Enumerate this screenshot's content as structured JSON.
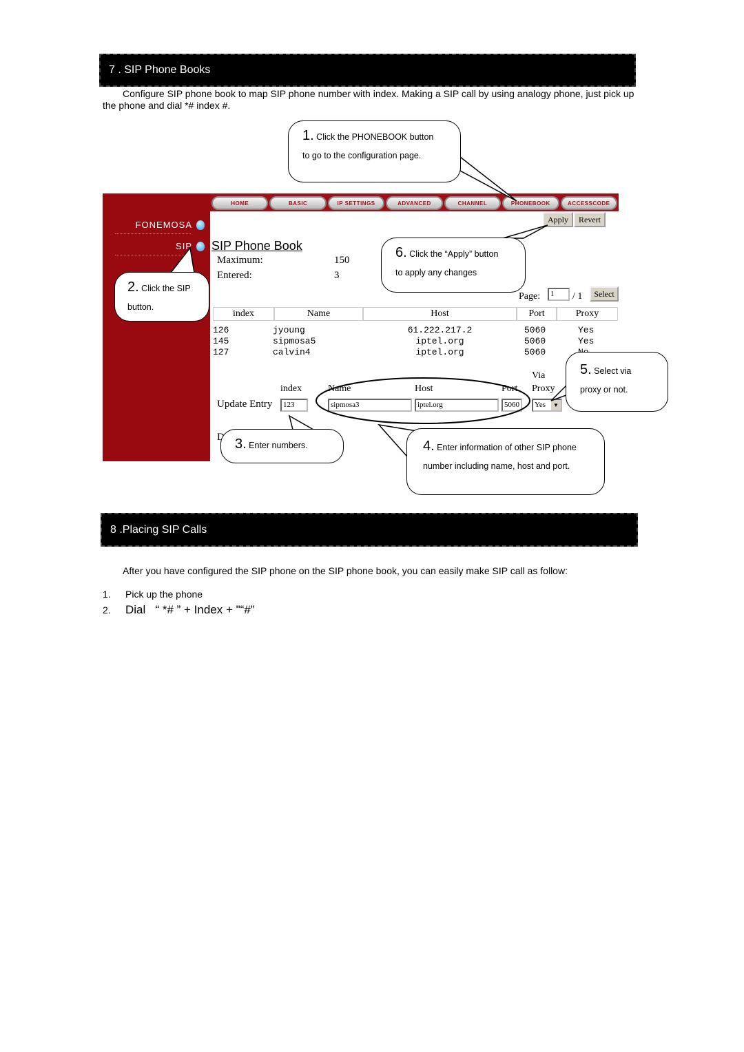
{
  "section7": {
    "title": "7 . SIP Phone Books",
    "intro": "Configure SIP phone book to map SIP phone number with index. Making a SIP call by using analogy phone, just pick up the phone and dial *# index #."
  },
  "screenshot": {
    "nav_tabs": [
      "HOME",
      "BASIC",
      "IP SETTINGS",
      "ADVANCED",
      "CHANNEL",
      "PHONEBOOK",
      "ACCESSCODE"
    ],
    "sidebar": [
      {
        "label": "FONEMOSA"
      },
      {
        "label": "SIP"
      }
    ],
    "apply_label": "Apply",
    "revert_label": "Revert",
    "page_title": "SIP Phone Book",
    "maximum_label": "Maximum:",
    "maximum_value": "150",
    "entered_label": "Entered:",
    "entered_value": "3",
    "page_label": "Page:",
    "page_value": "1",
    "page_total": "/ 1",
    "select_label": "Select",
    "columns": [
      "index",
      "Name",
      "Host",
      "Port",
      "Proxy"
    ],
    "rows": [
      {
        "index": "126",
        "name": "jyoung",
        "host": "61.222.217.2",
        "port": "5060",
        "proxy": "Yes"
      },
      {
        "index": "145",
        "name": "sipmosa5",
        "host": "iptel.org",
        "port": "5060",
        "proxy": "Yes"
      },
      {
        "index": "127",
        "name": "calvin4",
        "host": "iptel.org",
        "port": "5060",
        "proxy": "No"
      }
    ],
    "update": {
      "label": "Update Entry",
      "index_label": "index",
      "name_label": "Name",
      "host_label": "Host",
      "port_label": "Port",
      "via_label": "Via",
      "proxy_label": "Proxy",
      "index_value": "123",
      "name_value": "sipmosa3",
      "host_value": "iptel.org",
      "port_value": "5060",
      "proxy_value": "Yes"
    },
    "hidden_letter": "D"
  },
  "callouts": [
    {
      "num": "1.",
      "line1": "Click the PHONEBOOK button",
      "line2": "to go to the configuration page."
    },
    {
      "num": "2.",
      "line1": "Click the SIP",
      "line2": "button."
    },
    {
      "num": "3.",
      "line1": "Enter numbers.",
      "line2": ""
    },
    {
      "num": "4.",
      "line1": "Enter information of other SIP phone",
      "line2": "number including name, host and port."
    },
    {
      "num": "5.",
      "line1": "Select via",
      "line2": "proxy or not."
    },
    {
      "num": "6.",
      "line1": "Click the “Apply” button",
      "line2": "to apply any changes"
    }
  ],
  "section8": {
    "title": "8 .Placing SIP Calls",
    "intro": "After you have configured the SIP phone on the SIP phone book, you can easily make SIP call as follow:",
    "steps": [
      {
        "num": "1.",
        "text": "Pick up the phone"
      },
      {
        "num": "2.",
        "text": "Dial   “ *# ” + Index + \"“#”"
      }
    ]
  }
}
